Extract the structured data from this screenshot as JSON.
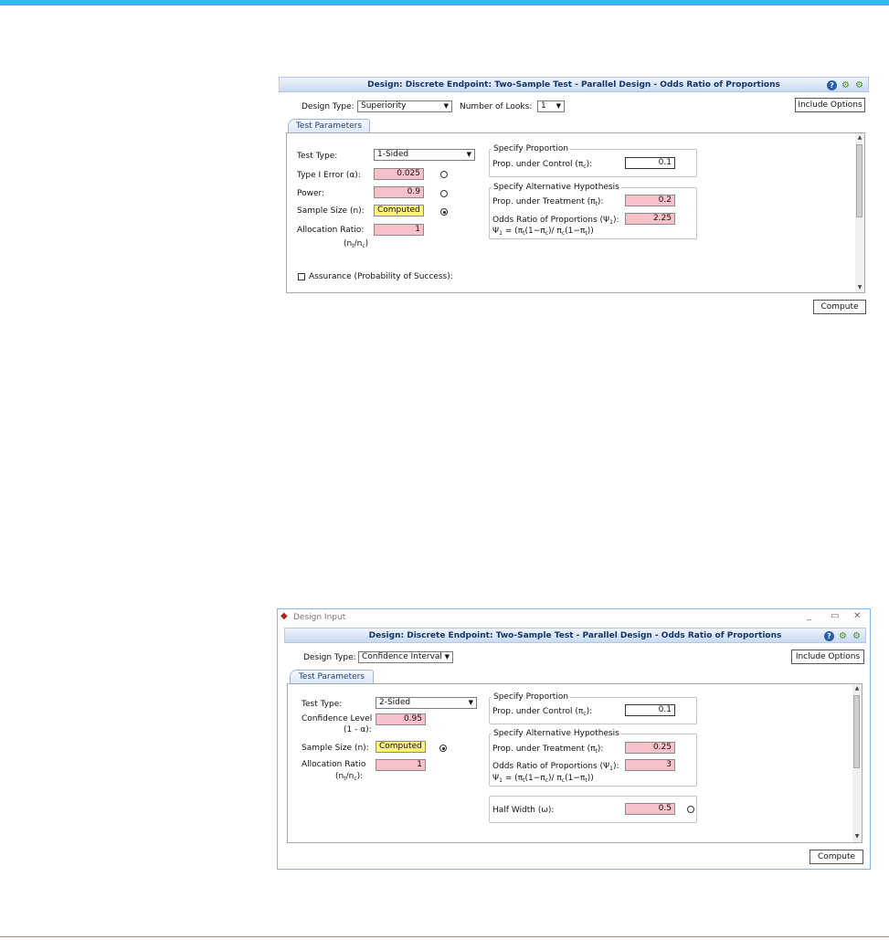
{
  "panel1": {
    "title": "Design: Discrete Endpoint: Two-Sample Test - Parallel Design - Odds Ratio of Proportions",
    "design_type_label": "Design Type:",
    "design_type_value": "Superiority",
    "looks_label": "Number of Looks:",
    "looks_value": "1",
    "include_options": "Include Options",
    "tab": "Test Parameters",
    "test_type_label": "Test Type:",
    "test_type_value": "1-Sided",
    "type1_label": "Type I Error (α):",
    "type1_value": "0.025",
    "power_label": "Power:",
    "power_value": "0.9",
    "sample_label": "Sample Size (n):",
    "sample_value": "Computed",
    "alloc_label": "Allocation Ratio:",
    "alloc_sub": "(n",
    "alloc_value": "1",
    "spec_prop_title": "Specify Proportion",
    "prop_control_label": "Prop. under Control (π",
    "prop_control_value": "0.1",
    "spec_alt_title": "Specify Alternative Hypothesis",
    "prop_treat_label": "Prop. under Treatment (π",
    "prop_treat_value": "0.2",
    "odds_label": "Odds Ratio of Proportions (Ψ",
    "odds_value": "2.25",
    "formula": "Ψ",
    "assurance_label": "Assurance (Probability of Success):",
    "compute": "Compute"
  },
  "panel2": {
    "window_title": "Design Input",
    "title": "Design: Discrete Endpoint: Two-Sample Test - Parallel Design - Odds Ratio of Proportions",
    "design_type_label": "Design Type:",
    "design_type_value": "Confidence Interval",
    "include_options": "Include Options",
    "tab": "Test Parameters",
    "test_type_label": "Test Type:",
    "test_type_value": "2-Sided",
    "conf_label": "Confidence Level",
    "conf_sub": "(1 - α):",
    "conf_value": "0.95",
    "sample_label": "Sample Size (n):",
    "sample_value": "Computed",
    "alloc_label": "Allocation Ratio",
    "alloc_value": "1",
    "spec_prop_title": "Specify Proportion",
    "prop_control_label": "Prop. under Control (π",
    "prop_control_value": "0.1",
    "spec_alt_title": "Specify Alternative Hypothesis",
    "prop_treat_label": "Prop. under Treatment (π",
    "prop_treat_value": "0.25",
    "odds_label": "Odds Ratio of Proportions (Ψ",
    "odds_value": "3",
    "half_width_label": "Half Width (ω):",
    "half_width_value": "0.5",
    "compute": "Compute"
  },
  "colors": {
    "accent": "#3ab4e8",
    "required": "#f7c1ca",
    "computed": "#fff27a"
  }
}
